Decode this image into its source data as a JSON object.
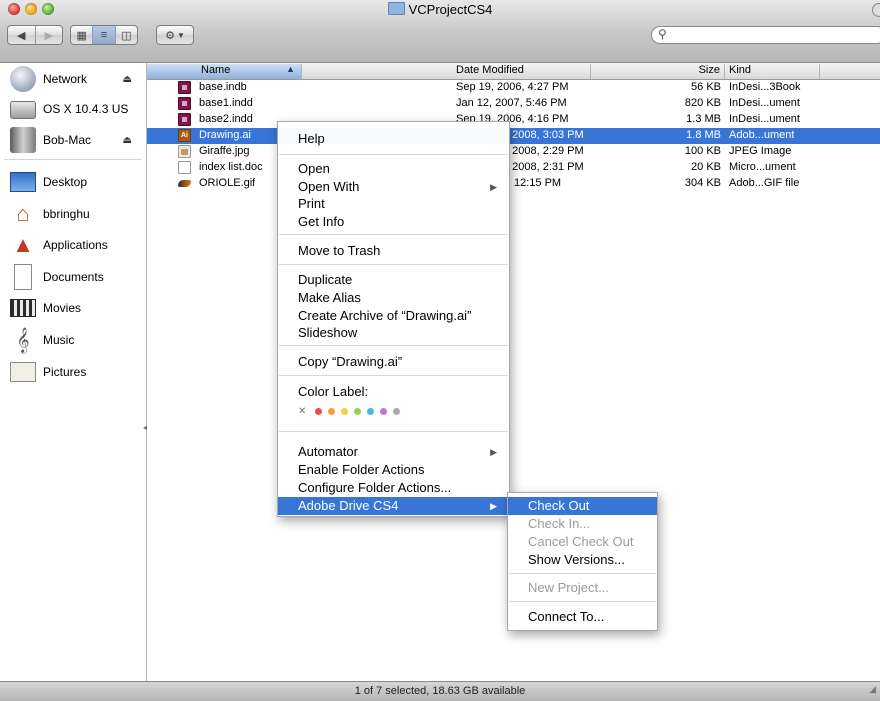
{
  "window": {
    "title": "VCProjectCS4"
  },
  "search": {
    "placeholder": ""
  },
  "sidebar": {
    "devices": [
      {
        "label": "Network",
        "icon": "network-globe-icon",
        "eject": true
      },
      {
        "label": "OS X 10.4.3 US",
        "icon": "hard-drive-icon",
        "eject": false
      },
      {
        "label": "Bob-Mac",
        "icon": "computer-icon",
        "eject": true
      }
    ],
    "places": [
      {
        "label": "Desktop",
        "icon": "desktop-icon"
      },
      {
        "label": "bbringhu",
        "icon": "home-icon"
      },
      {
        "label": "Applications",
        "icon": "applications-icon"
      },
      {
        "label": "Documents",
        "icon": "documents-icon"
      },
      {
        "label": "Movies",
        "icon": "movies-icon"
      },
      {
        "label": "Music",
        "icon": "music-icon"
      },
      {
        "label": "Pictures",
        "icon": "pictures-icon"
      }
    ]
  },
  "list": {
    "columns": {
      "name": "Name",
      "date": "Date Modified",
      "size": "Size",
      "kind": "Kind"
    },
    "rows": [
      {
        "name": "base.indb",
        "date": "Sep 19, 2006, 4:27 PM",
        "size": "56 KB",
        "kind": "InDesi...3Book",
        "icon": "indesign-book-icon",
        "selected": false
      },
      {
        "name": "base1.indd",
        "date": "Jan 12, 2007, 5:46 PM",
        "size": "820 KB",
        "kind": "InDesi...ument",
        "icon": "indesign-document-icon",
        "selected": false
      },
      {
        "name": "base2.indd",
        "date": "Sep 19, 2006, 4:16 PM",
        "size": "1.3 MB",
        "kind": "InDesi...ument",
        "icon": "indesign-document-icon",
        "selected": false
      },
      {
        "name": "Drawing.ai",
        "date": ", 2008, 3:03 PM",
        "size": "1.8 MB",
        "kind": "Adob...ument",
        "icon": "illustrator-document-icon",
        "selected": true
      },
      {
        "name": "Giraffe.jpg",
        "date": ", 2008, 2:29 PM",
        "size": "100 KB",
        "kind": "JPEG Image",
        "icon": "jpeg-image-icon",
        "selected": false
      },
      {
        "name": "index list.doc",
        "date": ", 2008, 2:31 PM",
        "size": "20 KB",
        "kind": "Micro...ument",
        "icon": "word-document-icon",
        "selected": false
      },
      {
        "name": "ORIOLE.gif",
        "date": "12:15 PM",
        "size": "304 KB",
        "kind": "Adob...GIF file",
        "icon": "gif-image-icon",
        "selected": false
      }
    ]
  },
  "context_menu": {
    "help": "Help",
    "open": "Open",
    "open_with": "Open With",
    "print": "Print",
    "get_info": "Get Info",
    "move_to_trash": "Move to Trash",
    "duplicate": "Duplicate",
    "make_alias": "Make Alias",
    "create_archive": "Create Archive of “Drawing.ai”",
    "slideshow": "Slideshow",
    "copy": "Copy “Drawing.ai”",
    "color_label": "Color Label:",
    "color_dots": [
      "#ee4c4c",
      "#f5a031",
      "#f2d23c",
      "#8fd152",
      "#4fb4ee",
      "#c174d4",
      "#a8a8a8"
    ],
    "automator": "Automator",
    "enable_folder_actions": "Enable Folder Actions",
    "configure_folder_actions": "Configure Folder Actions...",
    "adobe_drive": "Adobe Drive CS4"
  },
  "submenu": {
    "check_out": "Check Out",
    "check_in": "Check In...",
    "cancel_check_out": "Cancel Check Out",
    "show_versions": "Show Versions...",
    "new_project": "New Project...",
    "connect_to": "Connect To..."
  },
  "status": {
    "text": "1 of 7 selected, 18.63 GB available"
  },
  "colors": {
    "selection": "#3875d7"
  }
}
